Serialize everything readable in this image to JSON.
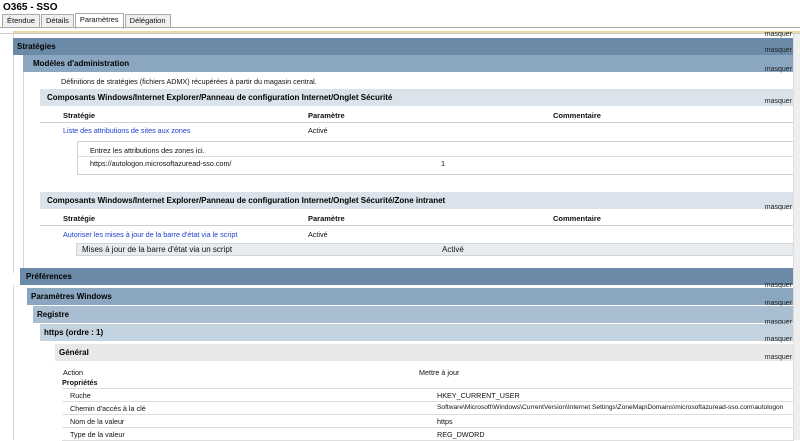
{
  "window_title": "O365 - SSO",
  "tabs": [
    "Étendue",
    "Détails",
    "Paramètres",
    "Délégation"
  ],
  "hide_label": "masquer",
  "strategies": {
    "title": "Stratégies",
    "admin_models": {
      "title": "Modèles d'administration",
      "note": "Définitions de stratégies (fichiers ADMX) récupérées à partir du magasin central.",
      "section1": {
        "title": "Composants Windows/Internet Explorer/Panneau de configuration Internet/Onglet Sécurité",
        "headers": [
          "Stratégie",
          "Paramètre",
          "Commentaire"
        ],
        "policy": "Liste des attributions de sites aux zones",
        "value": "Activé",
        "sub_title": "Entrez les attributions des zones ici.",
        "sub_site": "https://autologon.microsoftazuread-sso.com/",
        "sub_zone": "1"
      },
      "section2": {
        "title": "Composants Windows/Internet Explorer/Panneau de configuration Internet/Onglet Sécurité/Zone intranet",
        "headers": [
          "Stratégie",
          "Paramètre",
          "Commentaire"
        ],
        "policy": "Autoriser les mises à jour de la barre d'état via le script",
        "value": "Activé",
        "sub_label": "Mises à jour de la barre d'état via un script",
        "sub_value": "Activé"
      }
    }
  },
  "preferences": {
    "title": "Préférences",
    "windows_settings": "Paramètres Windows",
    "registry": "Registre",
    "https_item": "https (ordre : 1)",
    "general": "Général",
    "action_label": "Action",
    "action_value": "Mettre à jour",
    "properties_label": "Propriétés",
    "props": [
      {
        "label": "Ruche",
        "value": "HKEY_CURRENT_USER"
      },
      {
        "label": "Chemin d'accès à la clé",
        "value": "Software\\Microsoft\\Windows\\CurrentVersion\\Internet Settings\\ZoneMap\\Domains\\microsoftazuread-sso.com\\autologon"
      },
      {
        "label": "Nom de la valeur",
        "value": "https"
      },
      {
        "label": "Type de la valeur",
        "value": "REG_DWORD"
      }
    ]
  }
}
